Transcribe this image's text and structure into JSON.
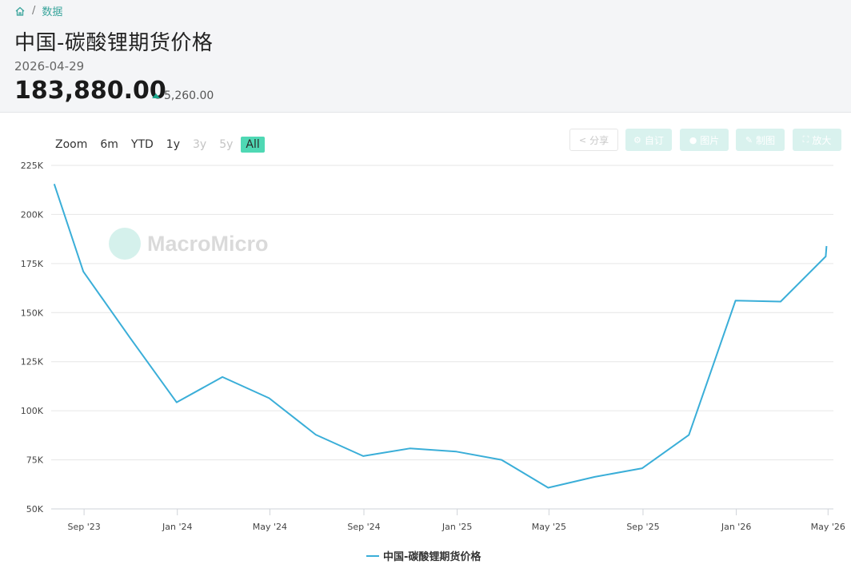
{
  "breadcrumb": {
    "home_icon": "home-icon",
    "separator": "/",
    "current": "数据"
  },
  "header": {
    "title": "中国-碳酸锂期货价格",
    "date": "2026-04-29",
    "price": "183,880.00",
    "change": "5,260.00",
    "change_direction": "up",
    "up_color": "#1aa78c"
  },
  "zoom": {
    "label": "Zoom",
    "buttons": [
      {
        "label": "6m",
        "state": "normal"
      },
      {
        "label": "YTD",
        "state": "normal"
      },
      {
        "label": "1y",
        "state": "normal"
      },
      {
        "label": "3y",
        "state": "disabled"
      },
      {
        "label": "5y",
        "state": "disabled"
      },
      {
        "label": "All",
        "state": "active"
      }
    ]
  },
  "toolbar": {
    "share": {
      "label": "分享",
      "icon": "share-icon"
    },
    "subscribe": {
      "label": "自订",
      "icon": "gear-icon"
    },
    "image": {
      "label": "图片",
      "icon": "user-icon"
    },
    "draw": {
      "label": "制图",
      "icon": "pencil-icon"
    },
    "expand": {
      "label": "放大",
      "icon": "expand-icon"
    }
  },
  "watermark": {
    "text": "MacroMicro"
  },
  "chart_data": {
    "type": "line",
    "title": "",
    "xlabel": "",
    "ylabel": "",
    "ylim": [
      50000,
      225000
    ],
    "y_ticks": [
      50000,
      75000,
      100000,
      125000,
      150000,
      175000,
      200000,
      225000
    ],
    "y_tick_labels": [
      "50K",
      "75K",
      "100K",
      "125K",
      "150K",
      "175K",
      "200K",
      "225K"
    ],
    "x_range": [
      "2023-07-20",
      "2026-05-08"
    ],
    "x_ticks": [
      "2023-09-01",
      "2024-01-01",
      "2024-05-01",
      "2024-09-01",
      "2025-01-01",
      "2025-05-01",
      "2025-09-01",
      "2026-01-01",
      "2026-05-01"
    ],
    "x_tick_labels": [
      "Sep '23",
      "Jan '24",
      "May '24",
      "Sep '24",
      "Jan '25",
      "May '25",
      "Sep '25",
      "Jan '26",
      "May '26"
    ],
    "grid": true,
    "legend": "bottom-center",
    "series": [
      {
        "name": "中国-碳酸锂期货价格",
        "color": "#3aaed8",
        "x": [
          "2023-07-24",
          "2023-08-31",
          "2023-10-31",
          "2023-12-31",
          "2024-02-29",
          "2024-04-30",
          "2024-06-30",
          "2024-08-31",
          "2024-10-31",
          "2024-12-31",
          "2025-02-28",
          "2025-04-30",
          "2025-06-30",
          "2025-08-31",
          "2025-10-31",
          "2025-12-31",
          "2026-02-28",
          "2026-04-28",
          "2026-04-29"
        ],
        "values": [
          215500,
          170900,
          137200,
          104300,
          117200,
          106400,
          87800,
          76900,
          80800,
          79200,
          75000,
          60800,
          66300,
          70700,
          87700,
          156100,
          155600,
          178600,
          183880
        ]
      }
    ]
  }
}
